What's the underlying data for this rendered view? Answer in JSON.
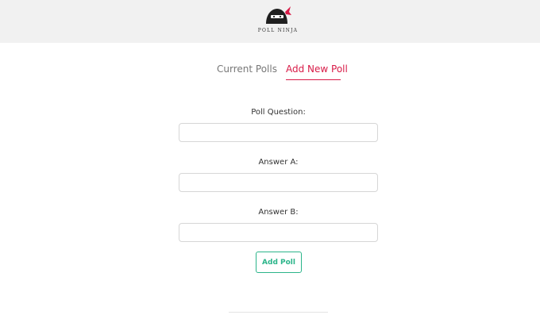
{
  "header": {
    "logo_text": "POLL NINJA",
    "logo_icon": "ninja-head-icon",
    "background": "#f1f1f1"
  },
  "tabs": [
    {
      "label": "Current Polls",
      "active": false
    },
    {
      "label": "Add New Poll",
      "active": true
    }
  ],
  "accent_color": "#d81b47",
  "form": {
    "question_label": "Poll Question:",
    "question_value": "",
    "answer_a_label": "Answer A:",
    "answer_a_value": "",
    "answer_b_label": "Answer B:",
    "answer_b_value": "",
    "submit_label": "Add Poll",
    "submit_color": "#2bb58a"
  }
}
